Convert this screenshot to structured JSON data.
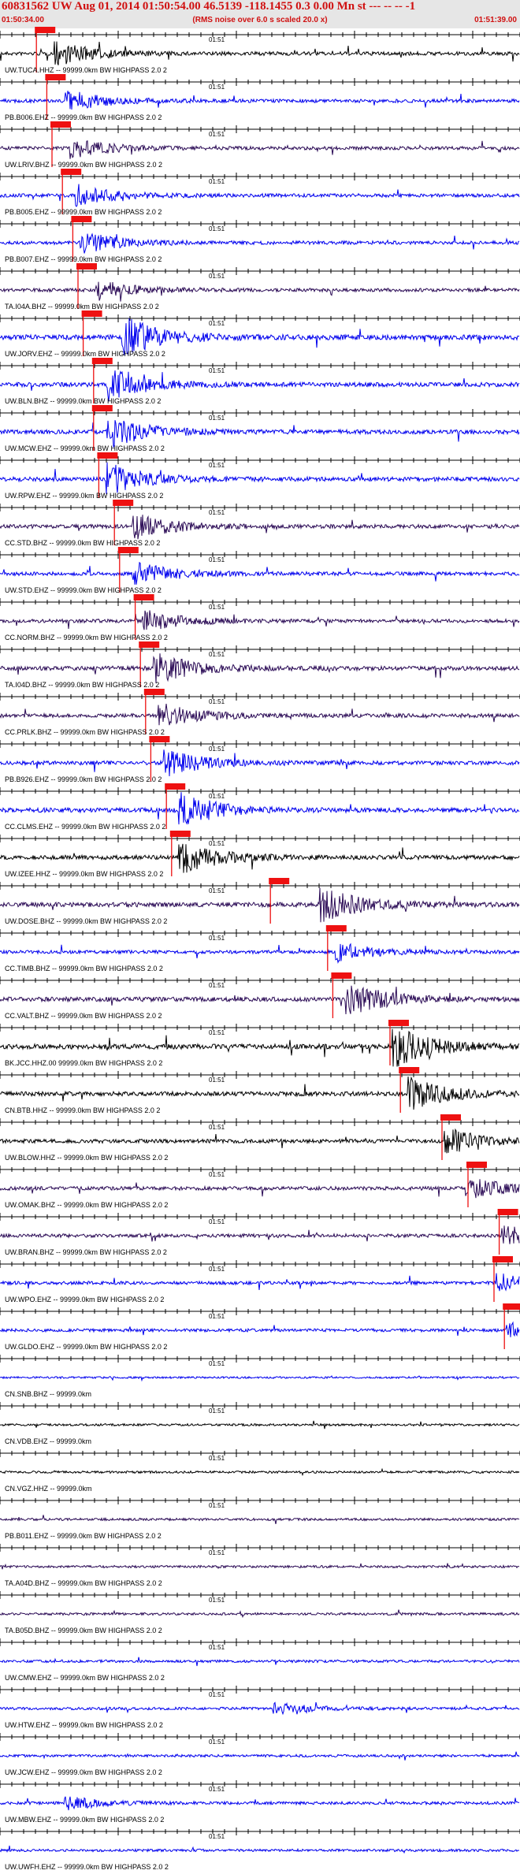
{
  "header": {
    "title": "60831562 UW Aug 01, 2014 01:50:54.00   46.5139 -118.1455  0.3 0.00 Mn st --- -- --  -1",
    "start_time": "01:50:34.00",
    "end_time": "01:51:39.00",
    "rms_note": "(RMS noise over 6.0 s scaled 20.0 x)"
  },
  "minute_label": "01:51",
  "colors": {
    "header_bg": "#e6e6e6",
    "header_text": "#d01010",
    "pick_box": "#ee1111",
    "black": "#000000",
    "blue": "#0000ee",
    "purple": "#2a0a55"
  },
  "traces": [
    {
      "label": "UW.TUCA.HHZ -- 99999.0km BW  HIGHPASS  2.0  2",
      "color": "black",
      "pick": 0.07,
      "event": 0.11,
      "amp": 0.55
    },
    {
      "label": "PB.B006.EHZ -- 99999.0km BW  HIGHPASS  2.0  2",
      "color": "blue",
      "pick": 0.09,
      "event": 0.13,
      "amp": 0.5
    },
    {
      "label": "UW.LRIV.BHZ -- 99999.0km BW  HIGHPASS  2.0  2",
      "color": "purple",
      "pick": 0.1,
      "event": 0.14,
      "amp": 0.45
    },
    {
      "label": "PB.B005.EHZ -- 99999.0km BW  HIGHPASS  2.0  2",
      "color": "blue",
      "pick": 0.12,
      "event": 0.15,
      "amp": 0.5
    },
    {
      "label": "PB.B007.EHZ -- 99999.0km BW  HIGHPASS  2.0  2",
      "color": "blue",
      "pick": 0.14,
      "event": 0.16,
      "amp": 0.5
    },
    {
      "label": "TA.I04A.BHZ -- 99999.0km BW  HIGHPASS  2.0  2",
      "color": "purple",
      "pick": 0.15,
      "event": 0.19,
      "amp": 0.45
    },
    {
      "label": "UW.JORV.EHZ -- 99999.0km BW  HIGHPASS  2.0  2",
      "color": "blue",
      "pick": 0.16,
      "event": 0.24,
      "amp": 0.95
    },
    {
      "label": "UW.BLN.BHZ -- 99999.0km BW  HIGHPASS  2.0  2",
      "color": "blue",
      "pick": 0.18,
      "event": 0.21,
      "amp": 0.75
    },
    {
      "label": "UW.MCW.EHZ -- 99999.0km BW  HIGHPASS  2.0  2",
      "color": "blue",
      "pick": 0.18,
      "event": 0.21,
      "amp": 0.75
    },
    {
      "label": "UW.RPW.EHZ -- 99999.0km BW  HIGHPASS  2.0  2",
      "color": "blue",
      "pick": 0.19,
      "event": 0.21,
      "amp": 0.75
    },
    {
      "label": "CC.STD.BHZ -- 99999.0km BW  HIGHPASS  2.0  2",
      "color": "purple",
      "pick": 0.22,
      "event": 0.26,
      "amp": 0.6
    },
    {
      "label": "UW.STD.EHZ -- 99999.0km BW  HIGHPASS  2.0  2",
      "color": "blue",
      "pick": 0.23,
      "event": 0.26,
      "amp": 0.55
    },
    {
      "label": "CC.NORM.BHZ -- 99999.0km BW  HIGHPASS  2.0  2",
      "color": "purple",
      "pick": 0.26,
      "event": 0.28,
      "amp": 0.5
    },
    {
      "label": "TA.I04D.BHZ -- 99999.0km BW  HIGHPASS  2.0  2",
      "color": "purple",
      "pick": 0.27,
      "event": 0.3,
      "amp": 0.75
    },
    {
      "label": "CC.PRLK.BHZ -- 99999.0km BW  HIGHPASS  2.0  2",
      "color": "purple",
      "pick": 0.28,
      "event": 0.31,
      "amp": 0.6
    },
    {
      "label": "PB.B926.EHZ -- 99999.0km BW  HIGHPASS  2.0  2",
      "color": "blue",
      "pick": 0.29,
      "event": 0.32,
      "amp": 0.65
    },
    {
      "label": "CC.CLMS.EHZ -- 99999.0km BW  HIGHPASS  2.0  2",
      "color": "blue",
      "pick": 0.32,
      "event": 0.35,
      "amp": 0.8
    },
    {
      "label": "UW.IZEE.HHZ -- 99999.0km BW  HIGHPASS  2.0  2",
      "color": "black",
      "pick": 0.33,
      "event": 0.35,
      "amp": 0.75
    },
    {
      "label": "UW.DOSE.BHZ -- 99999.0km BW  HIGHPASS  2.0  2",
      "color": "purple",
      "pick": 0.52,
      "event": 0.62,
      "amp": 0.85
    },
    {
      "label": "CC.TIMB.BHZ -- 99999.0km BW  HIGHPASS  2.0  2",
      "color": "blue",
      "pick": 0.63,
      "event": 0.65,
      "amp": 0.45
    },
    {
      "label": "CC.VALT.BHZ -- 99999.0km BW  HIGHPASS  2.0  2",
      "color": "purple",
      "pick": 0.64,
      "event": 0.67,
      "amp": 0.8
    },
    {
      "label": "BK.JCC.HHZ.00 99999.0km BW  HIGHPASS  2.0  2",
      "color": "black",
      "pick": 0.75,
      "event": 0.76,
      "amp": 0.95
    },
    {
      "label": "CN.BTB.HHZ -- 99999.0km BW  HIGHPASS  2.0  2",
      "color": "black",
      "pick": 0.77,
      "event": 0.79,
      "amp": 0.75
    },
    {
      "label": "UW.BLOW.HHZ -- 99999.0km BW  HIGHPASS  2.0  2",
      "color": "black",
      "pick": 0.85,
      "event": 0.86,
      "amp": 0.6
    },
    {
      "label": "UW.OMAK.BHZ -- 99999.0km BW  HIGHPASS  2.0  2",
      "color": "purple",
      "pick": 0.9,
      "event": 0.9,
      "amp": 0.55
    },
    {
      "label": "UW.BRAN.BHZ -- 99999.0km BW  HIGHPASS  2.0  2",
      "color": "purple",
      "pick": 0.96,
      "event": 0.97,
      "amp": 0.5
    },
    {
      "label": "UW.WPO.EHZ -- 99999.0km BW  HIGHPASS  2.0  2",
      "color": "blue",
      "pick": 0.95,
      "event": 0.96,
      "amp": 0.45
    },
    {
      "label": "UW.GLDO.EHZ -- 99999.0km BW  HIGHPASS  2.0  2",
      "color": "blue",
      "pick": 0.97,
      "event": 0.98,
      "amp": 0.35
    },
    {
      "label": "CN.SNB.BHZ -- 99999.0km",
      "color": "blue",
      "pick": null,
      "event": null,
      "amp": 0.0
    },
    {
      "label": "CN.VDB.EHZ -- 99999.0km",
      "color": "black",
      "pick": null,
      "event": null,
      "amp": 0.1
    },
    {
      "label": "CN.VGZ.HHZ -- 99999.0km",
      "color": "black",
      "pick": null,
      "event": null,
      "amp": 0.1
    },
    {
      "label": "PB.B011.EHZ -- 99999.0km BW  HIGHPASS  2.0  2",
      "color": "purple",
      "pick": null,
      "event": null,
      "amp": 0.15
    },
    {
      "label": "TA.A04D.BHZ -- 99999.0km BW  HIGHPASS  2.0  2",
      "color": "purple",
      "pick": null,
      "event": null,
      "amp": 0.15
    },
    {
      "label": "TA.B05D.BHZ -- 99999.0km BW  HIGHPASS  2.0  2",
      "color": "purple",
      "pick": null,
      "event": null,
      "amp": 0.15
    },
    {
      "label": "UW.CMW.EHZ -- 99999.0km BW  HIGHPASS  2.0  2",
      "color": "blue",
      "pick": null,
      "event": null,
      "amp": 0.2
    },
    {
      "label": "UW.HTW.EHZ -- 99999.0km BW  HIGHPASS  2.0  2",
      "color": "blue",
      "pick": null,
      "event": 0.53,
      "amp": 0.25
    },
    {
      "label": "UW.JCW.EHZ -- 99999.0km BW  HIGHPASS  2.0  2",
      "color": "blue",
      "pick": null,
      "event": null,
      "amp": 0.2
    },
    {
      "label": "UW.MBW.EHZ -- 99999.0km BW  HIGHPASS  2.0  2",
      "color": "blue",
      "pick": null,
      "event": 0.13,
      "amp": 0.3
    },
    {
      "label": "UW.UWFH.EHZ -- 99999.0km BW  HIGHPASS  2.0  2",
      "color": "blue",
      "pick": null,
      "event": null,
      "amp": 0.2
    }
  ]
}
